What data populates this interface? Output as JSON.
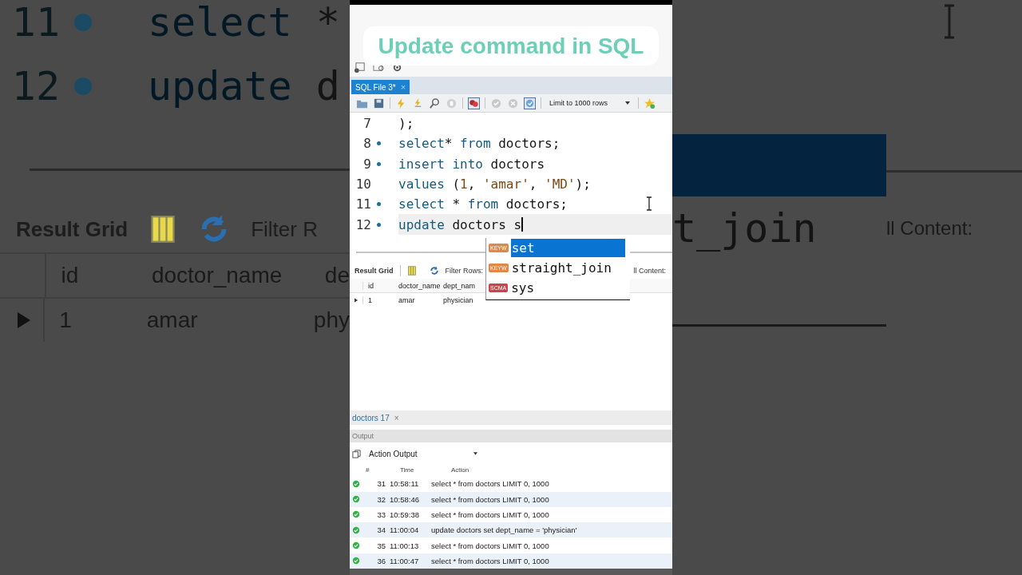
{
  "backdrop_left": {
    "code_lines": [
      {
        "number": "11",
        "bullet": true,
        "tokens": [
          {
            "kind": "keyword",
            "text": "select"
          },
          {
            "kind": "plain",
            "text": " *"
          }
        ]
      },
      {
        "number": "12",
        "bullet": true,
        "tokens": [
          {
            "kind": "keyword",
            "text": "update"
          },
          {
            "kind": "plain",
            "text": " d"
          }
        ]
      }
    ],
    "result_label": "Result Grid",
    "filter_label": "Filter R",
    "columns": [
      "id",
      "doctor_name",
      "de"
    ],
    "row": [
      "1",
      "amar",
      "phy"
    ]
  },
  "backdrop_right": {
    "completion": "t_join",
    "cell_content": "ll Content:"
  },
  "caption": "Update command in SQL",
  "editor_tab": {
    "label": "SQL File 3*",
    "close": "×"
  },
  "toolbar": {
    "limit": "Limit to 1000 rows"
  },
  "code_lines": [
    {
      "number": "7",
      "bullet": false,
      "current": false,
      "tokens": [
        {
          "kind": "plain",
          "text": ");"
        }
      ]
    },
    {
      "number": "8",
      "bullet": true,
      "current": false,
      "tokens": [
        {
          "kind": "keyword",
          "text": "select"
        },
        {
          "kind": "plain",
          "text": "* "
        },
        {
          "kind": "keyword",
          "text": "from"
        },
        {
          "kind": "plain",
          "text": " doctors;"
        }
      ]
    },
    {
      "number": "9",
      "bullet": true,
      "current": false,
      "tokens": [
        {
          "kind": "keyword",
          "text": "insert into"
        },
        {
          "kind": "plain",
          "text": " doctors"
        }
      ]
    },
    {
      "number": "10",
      "bullet": false,
      "current": false,
      "tokens": [
        {
          "kind": "keyword",
          "text": "values"
        },
        {
          "kind": "plain",
          "text": " ("
        },
        {
          "kind": "literal",
          "text": "1"
        },
        {
          "kind": "plain",
          "text": ", "
        },
        {
          "kind": "literal",
          "text": "'amar'"
        },
        {
          "kind": "plain",
          "text": ", "
        },
        {
          "kind": "literal",
          "text": "'MD'"
        },
        {
          "kind": "plain",
          "text": ");"
        }
      ]
    },
    {
      "number": "11",
      "bullet": true,
      "current": false,
      "tokens": [
        {
          "kind": "keyword",
          "text": "select"
        },
        {
          "kind": "plain",
          "text": " * "
        },
        {
          "kind": "keyword",
          "text": "from"
        },
        {
          "kind": "plain",
          "text": " doctors;"
        }
      ]
    },
    {
      "number": "12",
      "bullet": true,
      "current": true,
      "tokens": [
        {
          "kind": "keyword",
          "text": "update"
        },
        {
          "kind": "plain",
          "text": " doctors s"
        }
      ]
    }
  ],
  "autocomplete": [
    {
      "tag": "KEYW",
      "color": "#e0874a",
      "text": "set",
      "selected": true
    },
    {
      "tag": "KEYW",
      "color": "#e0874a",
      "text": "straight_join",
      "selected": false
    },
    {
      "tag": "SCMA",
      "color": "#c8454f",
      "text": "sys",
      "selected": false
    }
  ],
  "result_grid": {
    "label": "Result Grid",
    "filter": "Filter Rows:",
    "cell_content": "ll Content:",
    "columns": [
      "id",
      "doctor_name",
      "dept_nam"
    ],
    "rows": [
      [
        "1",
        "amar",
        "physician"
      ]
    ]
  },
  "result_tab": {
    "label": "doctors 17",
    "close": "×"
  },
  "output": {
    "title": "Output",
    "mode": "Action Output",
    "columns": [
      "#",
      "Time",
      "Action"
    ],
    "rows": [
      {
        "number": "31",
        "time": "10:58:11",
        "action": "select * from doctors LIMIT 0, 1000"
      },
      {
        "number": "32",
        "time": "10:58:46",
        "action": "select * from doctors LIMIT 0, 1000"
      },
      {
        "number": "33",
        "time": "10:59:38",
        "action": "select * from doctors LIMIT 0, 1000"
      },
      {
        "number": "34",
        "time": "11:00:04",
        "action": "update doctors set dept_name = 'physician'"
      },
      {
        "number": "35",
        "time": "11:00:13",
        "action": "select * from doctors LIMIT 0, 1000"
      },
      {
        "number": "36",
        "time": "11:00:47",
        "action": "select * from doctors LIMIT 0, 1000"
      }
    ]
  }
}
